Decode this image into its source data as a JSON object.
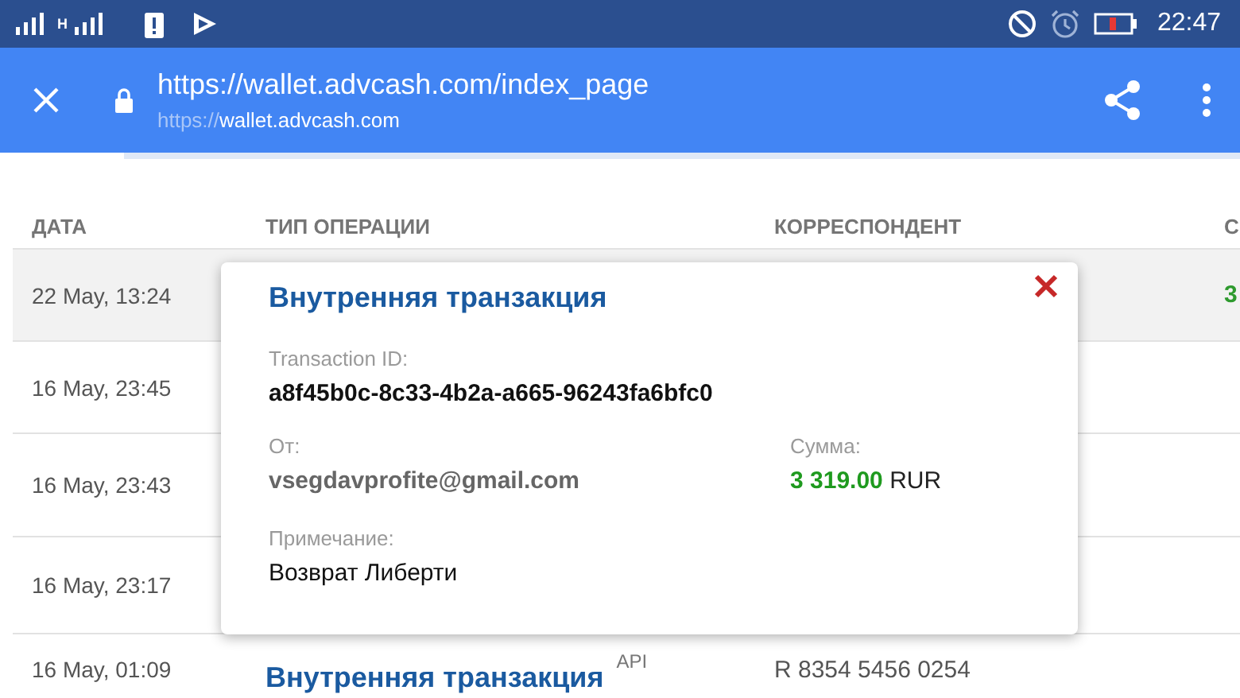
{
  "status_bar": {
    "network_type": "H",
    "time": "22:47"
  },
  "browser": {
    "url": "https://wallet.advcash.com/index_page",
    "host_prefix": "https://",
    "host": "wallet.advcash.com",
    "progress": {
      "level": 0.1
    }
  },
  "table": {
    "columns": [
      "ДАТА",
      "ТИП ОПЕРАЦИИ",
      "КОРРЕСПОНДЕНТ",
      "С"
    ],
    "rows": [
      {
        "date": "22 May, 13:24",
        "column_4": "3",
        "selected": true
      },
      {
        "date": "16 May, 23:45",
        "selected": false
      },
      {
        "date": "16 May, 23:43",
        "selected": false
      },
      {
        "date": "16 May, 23:17",
        "selected": false
      },
      {
        "date": "16 May, 01:09",
        "type": "Внутренняя транзакция",
        "type_tag": "API",
        "correspondent": "R 8354 5456 0254",
        "selected": false
      }
    ]
  },
  "popup": {
    "title": "Внутренняя транзакция",
    "transaction_id_label": "Transaction ID:",
    "transaction_id": "a8f45b0c-8c33-4b2a-a665-96243fa6bfc0",
    "from_label": "От:",
    "from": "vsegdavprofite@gmail.com",
    "amount_label": "Сумма:",
    "amount": "3 319.00",
    "currency": "RUR",
    "note_label": "Примечание:",
    "note": "Возврат Либерти"
  }
}
